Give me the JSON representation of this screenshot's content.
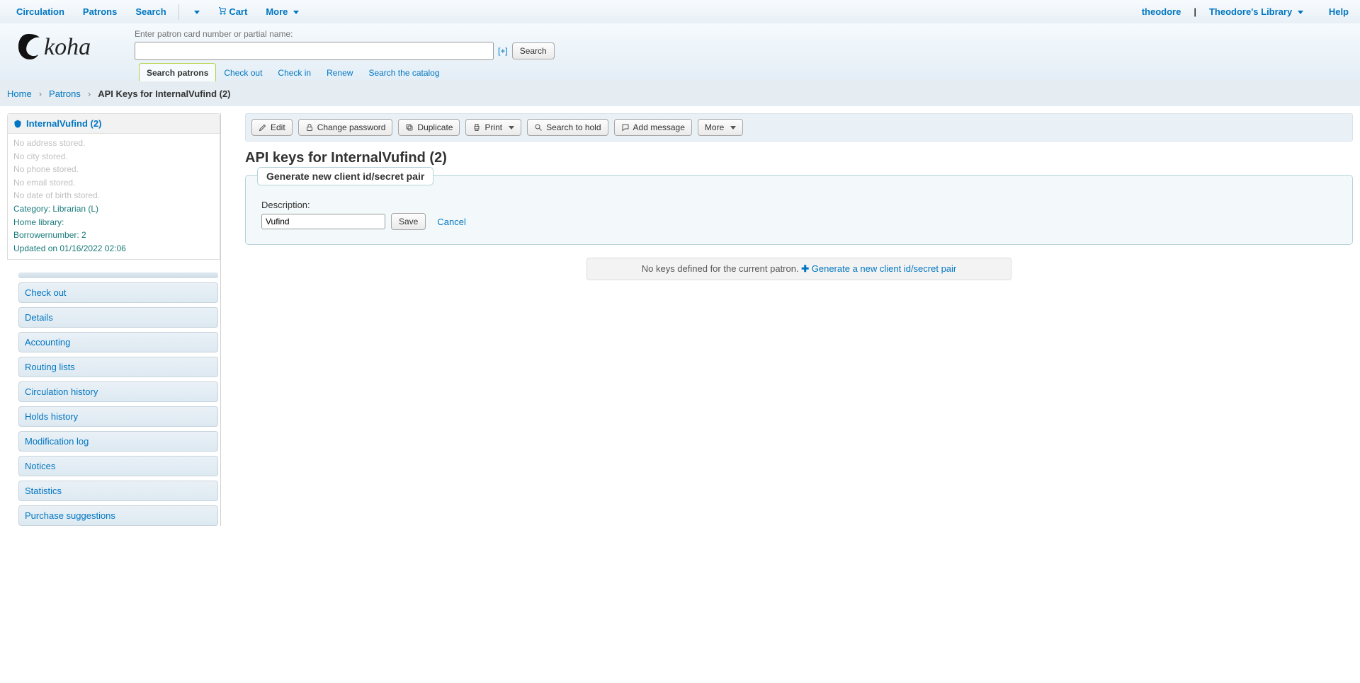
{
  "topnav": {
    "circulation": "Circulation",
    "patrons": "Patrons",
    "search": "Search",
    "cart": "Cart",
    "more": "More",
    "user": "theodore",
    "library": "Theodore's Library",
    "help": "Help"
  },
  "search": {
    "label": "Enter patron card number or partial name:",
    "expand": "[+]",
    "button": "Search",
    "tabs": {
      "search_patrons": "Search patrons",
      "check_out": "Check out",
      "check_in": "Check in",
      "renew": "Renew",
      "search_catalog": "Search the catalog"
    }
  },
  "breadcrumb": {
    "home": "Home",
    "patrons": "Patrons",
    "current": "API Keys for InternalVufind (2)"
  },
  "patron": {
    "name": "InternalVufind (2)",
    "no_address": "No address stored.",
    "no_city": "No city stored.",
    "no_phone": "No phone stored.",
    "no_email": "No email stored.",
    "no_dob": "No date of birth stored.",
    "category": "Category: Librarian (L)",
    "home_library": "Home library:",
    "borrowernumber": "Borrowernumber: 2",
    "updated": "Updated on 01/16/2022 02:06"
  },
  "sidemenu": [
    "Check out",
    "Details",
    "Accounting",
    "Routing lists",
    "Circulation history",
    "Holds history",
    "Modification log",
    "Notices",
    "Statistics",
    "Purchase suggestions"
  ],
  "toolbar": {
    "edit": "Edit",
    "change_password": "Change password",
    "duplicate": "Duplicate",
    "print": "Print",
    "search_to_hold": "Search to hold",
    "add_message": "Add message",
    "more": "More"
  },
  "page": {
    "title": "API keys for InternalVufind (2)",
    "fieldset_legend": "Generate new client id/secret pair",
    "description_label": "Description:",
    "description_value": "Vufind",
    "save": "Save",
    "cancel": "Cancel",
    "no_keys": "No keys defined for the current patron.",
    "generate_link": "Generate a new client id/secret pair"
  }
}
